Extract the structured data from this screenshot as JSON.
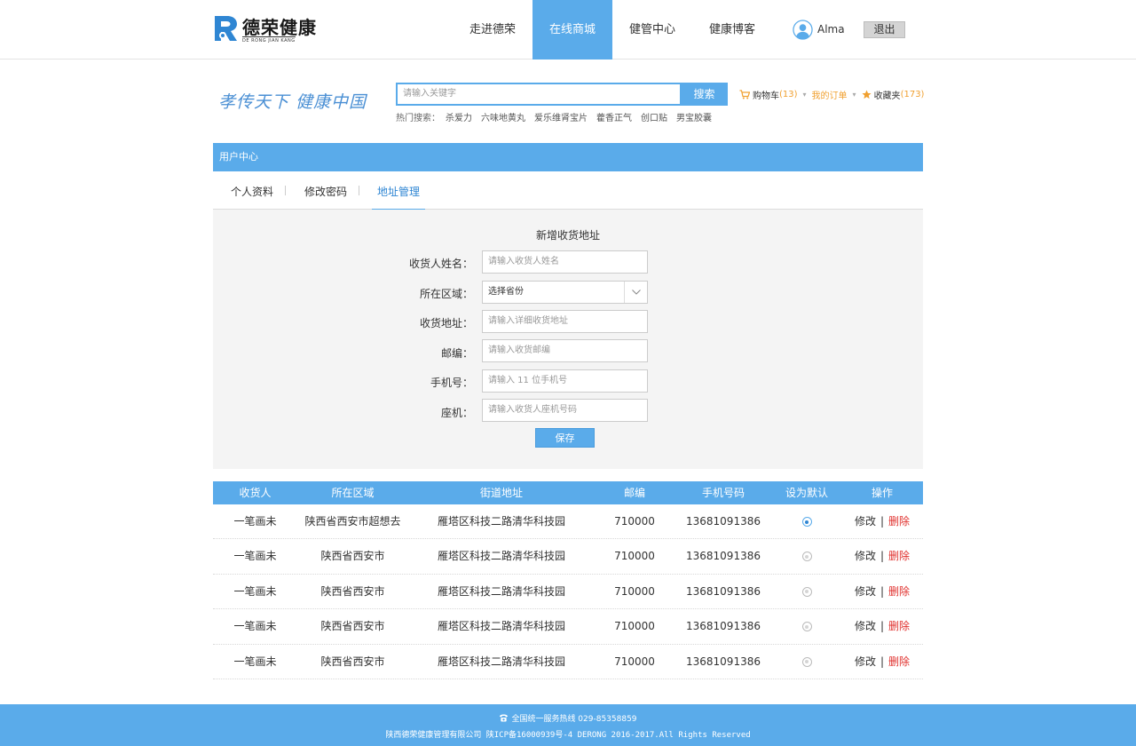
{
  "brand": {
    "name": "德荣健康",
    "subtitle": "DE RONG JIAN KANG",
    "logo_color": "#2f86d3"
  },
  "nav": {
    "items": [
      {
        "label": "走进德荣",
        "active": false
      },
      {
        "label": "在线商城",
        "active": true
      },
      {
        "label": "健管中心",
        "active": false
      },
      {
        "label": "健康博客",
        "active": false
      }
    ]
  },
  "user": {
    "name": "Alma",
    "logout_label": "退出"
  },
  "slogan": "孝传天下 健康中国",
  "search": {
    "placeholder": "请输入关键字",
    "button_label": "搜索",
    "hot_label": "热门搜索：",
    "hot_items": [
      "杀爱力",
      "六味地黄丸",
      "爱乐维肾宝片",
      "藿香正气",
      "创口贴",
      "男宝胶囊"
    ]
  },
  "quicklinks": {
    "cart_label": "购物车",
    "cart_count": "(13)",
    "orders_label": "我的订单",
    "favorites_label": "收藏夹",
    "favorites_count": "(173)"
  },
  "user_center": {
    "title": "用户中心",
    "tabs": [
      {
        "label": "个人资料",
        "active": false
      },
      {
        "label": "修改密码",
        "active": false
      },
      {
        "label": "地址管理",
        "active": true
      }
    ]
  },
  "form": {
    "title": "新增收货地址",
    "fields": [
      {
        "label": "收货人姓名：",
        "placeholder": "请输入收货人姓名"
      },
      {
        "label": "所在区域：",
        "select_value": "选择省份"
      },
      {
        "label": "收货地址：",
        "placeholder": "请输入详细收货地址"
      },
      {
        "label": "邮编：",
        "placeholder": "请输入收货邮编"
      },
      {
        "label": "手机号：",
        "placeholder": "请输入 11 位手机号"
      },
      {
        "label": "座机：",
        "placeholder": "请输入收货人座机号码"
      }
    ],
    "save_label": "保存"
  },
  "table": {
    "headers": [
      "收货人",
      "所在区域",
      "街道地址",
      "邮编",
      "手机号码",
      "设为默认",
      "操作"
    ],
    "edit_label": "修改",
    "sep_label": "|",
    "delete_label": "删除",
    "rows": [
      {
        "name": "一笔画未",
        "region": "陕西省西安市超想去",
        "street": "雁塔区科技二路清华科技园",
        "zip": "710000",
        "phone": "13681091386",
        "default": true
      },
      {
        "name": "一笔画未",
        "region": "陕西省西安市",
        "street": "雁塔区科技二路清华科技园",
        "zip": "710000",
        "phone": "13681091386",
        "default": false
      },
      {
        "name": "一笔画未",
        "region": "陕西省西安市",
        "street": "雁塔区科技二路清华科技园",
        "zip": "710000",
        "phone": "13681091386",
        "default": false
      },
      {
        "name": "一笔画未",
        "region": "陕西省西安市",
        "street": "雁塔区科技二路清华科技园",
        "zip": "710000",
        "phone": "13681091386",
        "default": false
      },
      {
        "name": "一笔画未",
        "region": "陕西省西安市",
        "street": "雁塔区科技二路清华科技园",
        "zip": "710000",
        "phone": "13681091386",
        "default": false
      }
    ]
  },
  "footer": {
    "hotline": "全国统一服务热线  029-85358859",
    "copyright": "陕西德荣健康管理有限公司 陕ICP备16000939号-4  DERONG 2016-2017.All Rights Reserved"
  },
  "colors": {
    "accent": "#5aabea",
    "accent_dark": "#2f86d3",
    "delete_red": "#e0312e",
    "count_orange": "#f0a030"
  },
  "icons": [
    "logo-r-icon",
    "user-avatar-icon",
    "cart-icon",
    "star-icon",
    "chevron-down-icon",
    "phone-icon"
  ]
}
